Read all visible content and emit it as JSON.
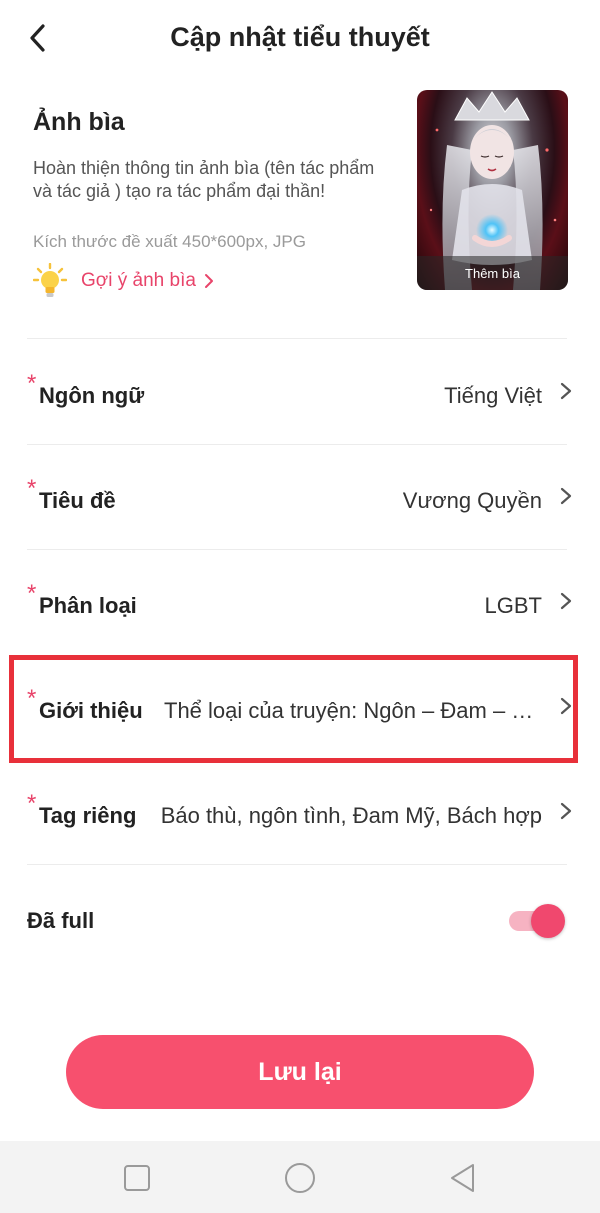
{
  "header": {
    "title": "Cập nhật tiểu thuyết",
    "back_icon": "chevron-left-icon"
  },
  "cover": {
    "heading": "Ảnh bìa",
    "description": "Hoàn thiện thông tin ảnh bìa (tên tác phẩm và tác giả ) tạo ra tác phẩm đại thần!",
    "size_hint": "Kích thước đề xuất 450*600px, JPG",
    "suggestion_label": "Gợi ý ảnh bìa",
    "suggestion_icon": "lightbulb-icon",
    "thumbnail_caption": "Thêm bìa"
  },
  "fields": [
    {
      "label": "Ngôn ngữ",
      "value": "Tiếng Việt",
      "required": "*"
    },
    {
      "label": "Tiêu đề",
      "value": "Vương Quyền",
      "required": "*"
    },
    {
      "label": "Phân loại",
      "value": "LGBT",
      "required": "*"
    },
    {
      "label": "Giới thiệu",
      "value": "Thể loại của truyện: Ngôn – Đam – Bách – Hành động – Cung đấu – Trọng sinh",
      "required": "*"
    },
    {
      "label": "Tag riêng",
      "value": "Báo thù, ngôn tình, Đam Mỹ, Bách hợp",
      "required": "*"
    }
  ],
  "completed": {
    "label": "Đã full",
    "enabled": true
  },
  "save_button": "Lưu lại",
  "system_nav": {
    "recent": "square-icon",
    "home": "circle-icon",
    "back": "triangle-back-icon"
  },
  "colors": {
    "accent": "#f7506e",
    "required": "#e8446a",
    "highlight": "#e8303a"
  }
}
